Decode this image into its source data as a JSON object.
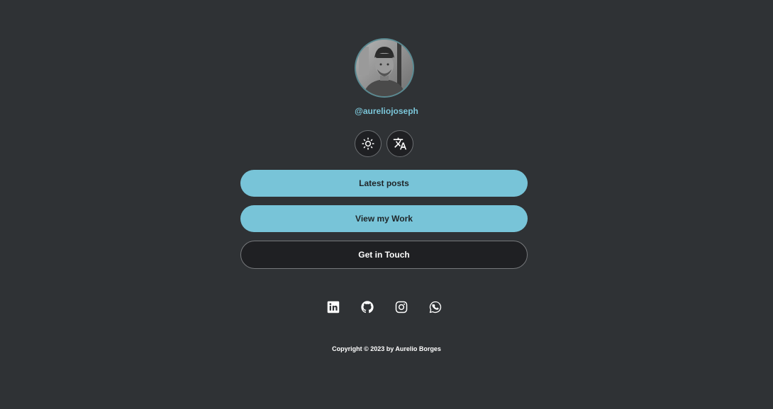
{
  "profile": {
    "handle": "@aureliojoseph"
  },
  "controls": {
    "theme_icon": "sun-icon",
    "language_icon": "translate-icon"
  },
  "links": [
    {
      "label": "Latest posts",
      "style": "primary"
    },
    {
      "label": "View my Work",
      "style": "primary"
    },
    {
      "label": "Get in Touch",
      "style": "dark"
    }
  ],
  "social": [
    {
      "icon": "linkedin-icon"
    },
    {
      "icon": "github-icon"
    },
    {
      "icon": "instagram-icon"
    },
    {
      "icon": "whatsapp-icon"
    }
  ],
  "footer": {
    "copyright": "Copyright © 2023 by Aurelio Borges"
  },
  "colors": {
    "background": "#2f3235",
    "accent": "#78c4d8",
    "dark_button": "#1f2023",
    "text_light": "#ffffff"
  }
}
